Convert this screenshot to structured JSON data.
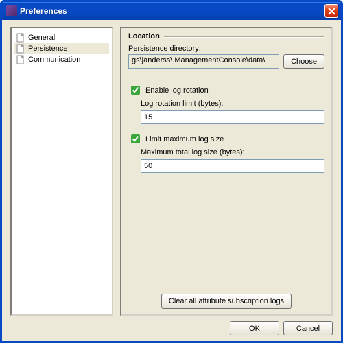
{
  "window": {
    "title": "Preferences"
  },
  "tree": {
    "items": [
      {
        "label": "General",
        "selected": false
      },
      {
        "label": "Persistence",
        "selected": true
      },
      {
        "label": "Communication",
        "selected": false
      }
    ]
  },
  "content": {
    "location": {
      "legend": "Location",
      "directory_label": "Persistence directory:",
      "directory_value": "gs\\janderss\\.ManagementConsole\\data\\",
      "choose_label": "Choose"
    },
    "rotation": {
      "enable_label": "Enable log rotation",
      "enable_checked": true,
      "limit_label": "Log rotation limit (bytes):",
      "limit_value": "15"
    },
    "maxsize": {
      "enable_label": "Limit maximum log size",
      "enable_checked": true,
      "limit_label": "Maximum total log size (bytes):",
      "limit_value": "50"
    },
    "clear_label": "Clear all attribute subscription logs"
  },
  "buttons": {
    "ok": "OK",
    "cancel": "Cancel"
  }
}
